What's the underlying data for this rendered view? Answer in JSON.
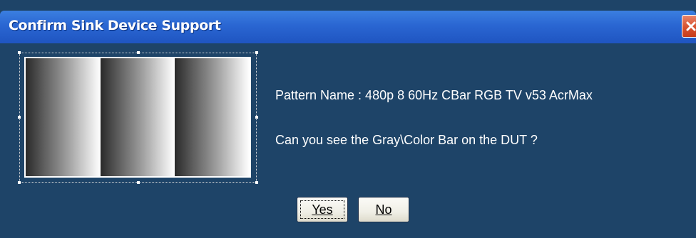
{
  "dialog": {
    "title": "Confirm Sink Device Support",
    "close_icon": "close-x-icon",
    "pattern_preview": "gray-bar-pattern",
    "pattern_name_text": "Pattern Name : 480p 8 60Hz CBar RGB TV v53 AcrMax",
    "question_text": "Can you see the Gray\\Color Bar on the DUT ?",
    "buttons": {
      "yes_label": "Yes",
      "no_label": "No"
    }
  },
  "colors": {
    "dialog_background": "#1e4468",
    "titlebar": "#2a66d2",
    "close_button": "#d7512e",
    "button_face": "#f0efe6"
  }
}
